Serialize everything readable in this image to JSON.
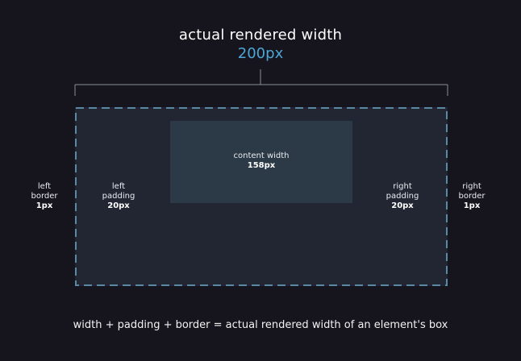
{
  "header": {
    "title": "actual rendered width",
    "value": "200px"
  },
  "content": {
    "label": "content width",
    "value": "158px"
  },
  "left_border": {
    "line1": "left",
    "line2": "border",
    "value": "1px"
  },
  "left_padding": {
    "line1": "left",
    "line2": "padding",
    "value": "20px"
  },
  "right_padding": {
    "line1": "right",
    "line2": "padding",
    "value": "20px"
  },
  "right_border": {
    "line1": "right",
    "line2": "border",
    "value": "1px"
  },
  "caption": "width + padding + border = actual rendered width of an element's box",
  "colors": {
    "background": "#16151d",
    "box": "#222633",
    "content": "#2c3a48",
    "accent": "#4ea6d6",
    "dashed_border": "#5a8aa3"
  }
}
